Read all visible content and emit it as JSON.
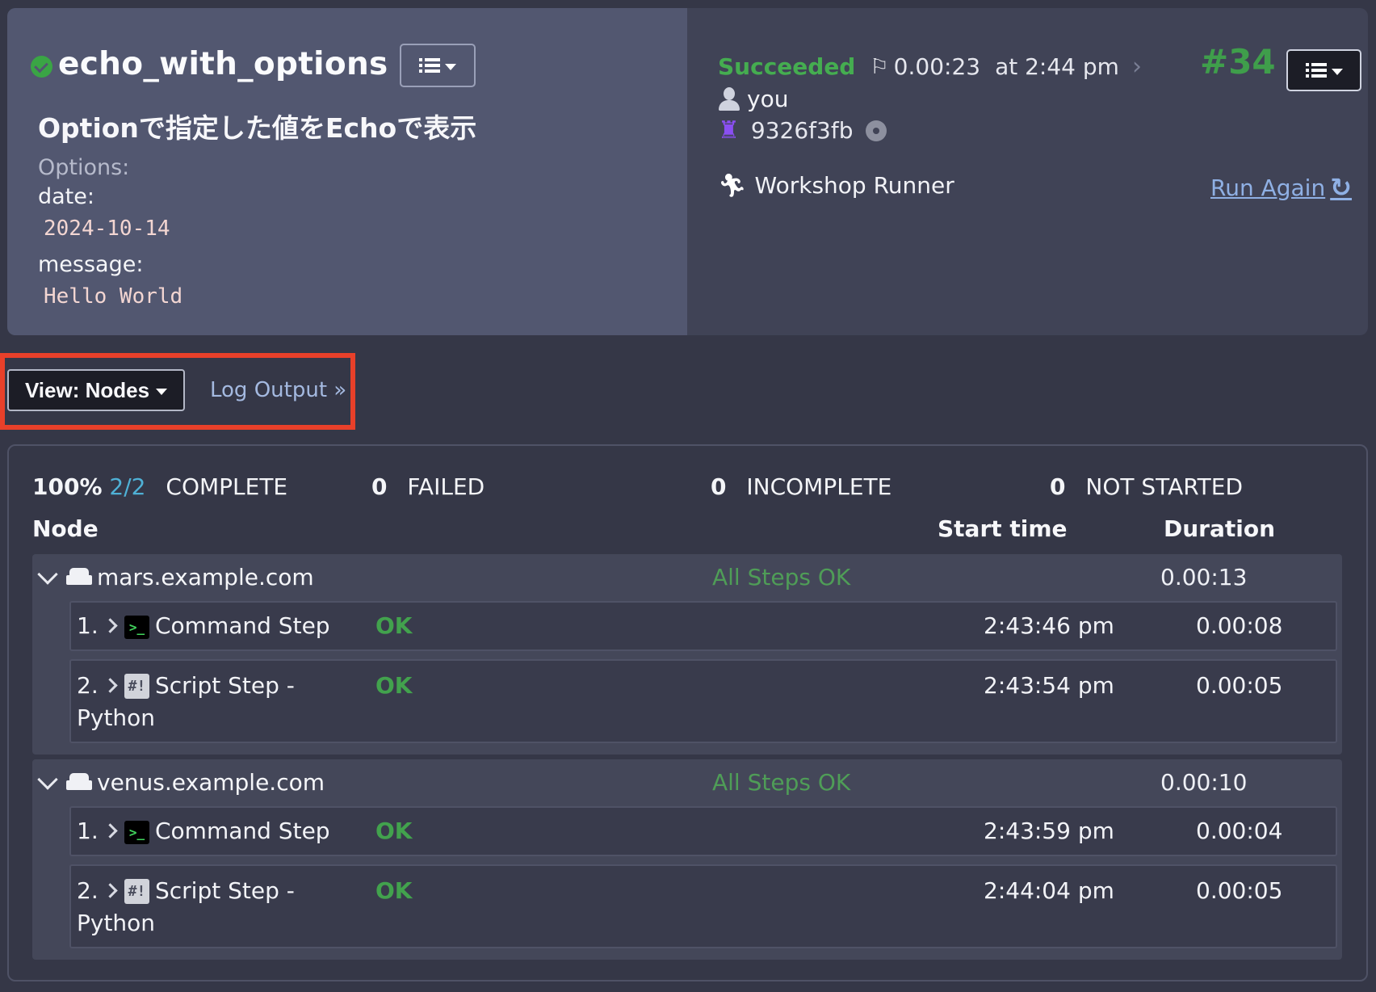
{
  "job": {
    "name": "echo_with_options",
    "description": "Optionで指定した値をEchoで表示",
    "options_label": "Options:",
    "options": [
      {
        "key": "date:",
        "value": "2024-10-14"
      },
      {
        "key": "message:",
        "value": "Hello World"
      }
    ]
  },
  "execution": {
    "status": "Succeeded",
    "duration": "0.00:23",
    "at_time": "at 2:44 pm",
    "run_number": "#34",
    "user": "you",
    "commit": "9326f3fb",
    "runner": "Workshop Runner",
    "run_again_label": "Run Again"
  },
  "viewbar": {
    "view_label": "View: Nodes",
    "log_output_label": "Log Output »"
  },
  "summary": {
    "percent": "100%",
    "fraction": "2/2",
    "complete_label": "COMPLETE",
    "failed_count": "0",
    "failed_label": "FAILED",
    "incomplete_count": "0",
    "incomplete_label": "INCOMPLETE",
    "not_started_count": "0",
    "not_started_label": "NOT STARTED"
  },
  "table": {
    "col_node": "Node",
    "col_start": "Start time",
    "col_duration": "Duration"
  },
  "nodes": [
    {
      "name": "mars.example.com",
      "status": "All Steps OK",
      "duration": "0.00:13",
      "steps": [
        {
          "num": "1.",
          "name": "Command Step",
          "name_cont": "",
          "icon": "terminal-icon",
          "status": "OK",
          "start": "2:43:46 pm",
          "duration": "0.00:08"
        },
        {
          "num": "2.",
          "name": "Script Step -",
          "name_cont": "Python",
          "icon": "script-icon",
          "status": "OK",
          "start": "2:43:54 pm",
          "duration": "0.00:05"
        }
      ]
    },
    {
      "name": "venus.example.com",
      "status": "All Steps OK",
      "duration": "0.00:10",
      "steps": [
        {
          "num": "1.",
          "name": "Command Step",
          "name_cont": "",
          "icon": "terminal-icon",
          "status": "OK",
          "start": "2:43:59 pm",
          "duration": "0.00:04"
        },
        {
          "num": "2.",
          "name": "Script Step -",
          "name_cont": "Python",
          "icon": "script-icon",
          "status": "OK",
          "start": "2:44:04 pm",
          "duration": "0.00:05"
        }
      ]
    }
  ],
  "colors": {
    "success": "#45ad50",
    "link": "#8fb0e4",
    "highlight": "#e8402a",
    "fraction": "#4fb1d6"
  }
}
